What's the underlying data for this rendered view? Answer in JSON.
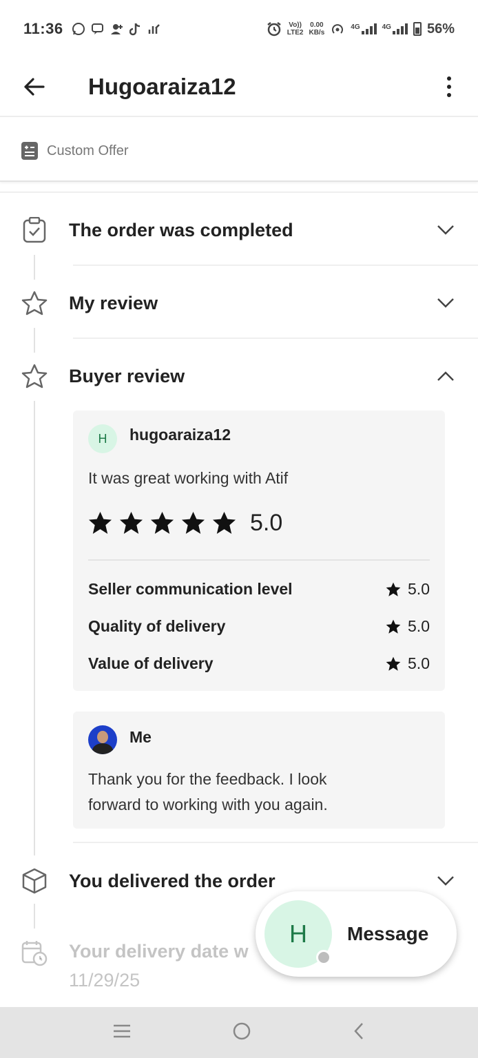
{
  "status_bar": {
    "time": "11:36",
    "net_top": "Vo))",
    "net_bottom": "LTE2",
    "speed_top": "0.00",
    "speed_bottom": "KB/s",
    "net_4g_1": "4G",
    "net_4g_2": "4G",
    "battery": "56%"
  },
  "header": {
    "title": "Hugoaraiza12"
  },
  "custom_offer": {
    "label": "Custom Offer"
  },
  "timeline": {
    "order_completed": "The order was completed",
    "my_review": "My review",
    "buyer_review": "Buyer review",
    "delivered": "You delivered the order",
    "delivery_date_label": "Your delivery date w",
    "delivery_date": "11/29/25"
  },
  "buyer_review": {
    "avatar_initial": "H",
    "username": "hugoaraiza12",
    "text": "It was great working with Atif",
    "stars": 5,
    "score": "5.0",
    "ratings": [
      {
        "label": "Seller communication level",
        "value": "5.0"
      },
      {
        "label": "Quality of delivery",
        "value": "5.0"
      },
      {
        "label": "Value of delivery",
        "value": "5.0"
      }
    ]
  },
  "my_reply": {
    "name": "Me",
    "text_line1": "Thank you for the feedback. I look",
    "text_line2": "forward to working with you again."
  },
  "message_fab": {
    "avatar_initial": "H",
    "label": "Message"
  },
  "colors": {
    "avatar_bg": "#d8f5e5",
    "avatar_text": "#1d7a48",
    "card_bg": "#f5f5f5",
    "nav_bg": "#e4e4e4"
  }
}
